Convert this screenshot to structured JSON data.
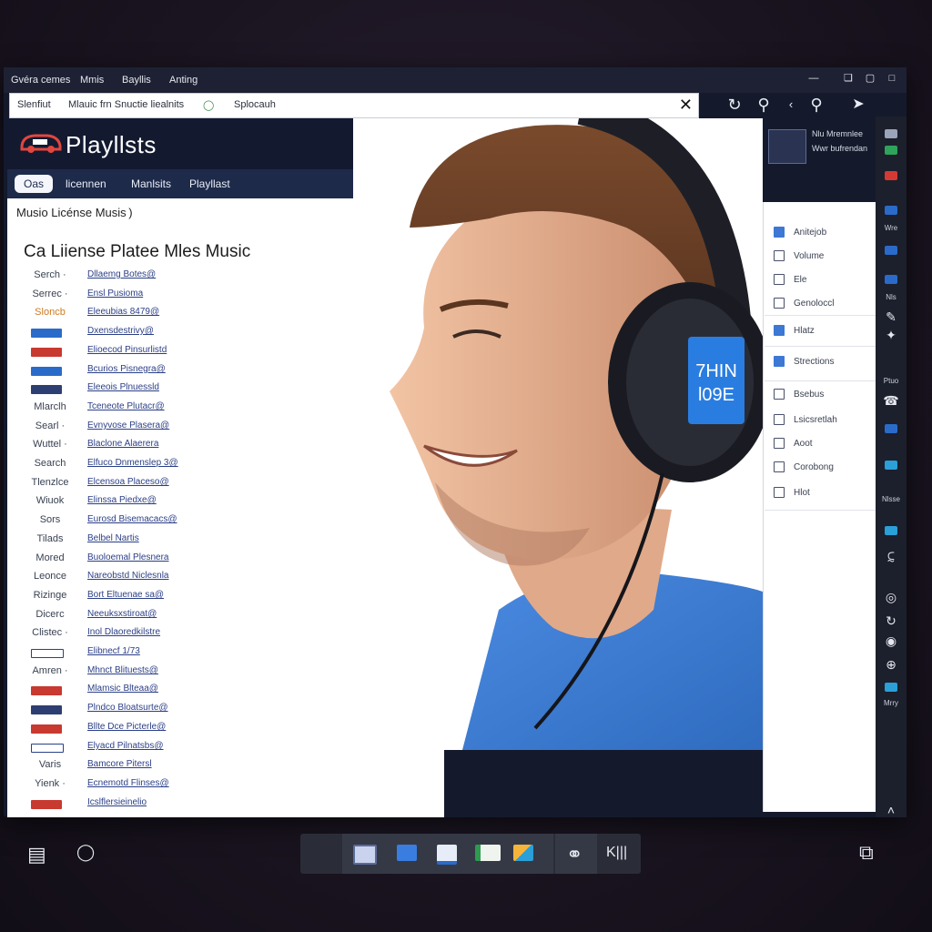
{
  "menubar": {
    "items": [
      "Gvéra cemes",
      "Mmis",
      "Bayllis",
      "Anting"
    ]
  },
  "addressbar": {
    "left_text": "Slenfiut",
    "path_text": "Mlauic frn Snuctie liealnits",
    "status_text": "Splocauh"
  },
  "header": {
    "title": "Playllsts"
  },
  "nav": {
    "tabs": [
      "Oas",
      "licennen",
      "Manlsits",
      "Playllast"
    ]
  },
  "breadcrumb": "Musio Licénse Musis )",
  "page_title": "Ca Liiense Platee  Mles Music",
  "rows": [
    {
      "label": "Serch ·",
      "value": "Dllaemg Botes@"
    },
    {
      "label": "Serrec ·",
      "value": "Ensl Pusioma"
    },
    {
      "label": "Sloncb",
      "value": "Eleeubias 8479@"
    },
    {
      "badge": "blue",
      "value": "Dxensdestrivy@"
    },
    {
      "badge": "red",
      "value": "Elioecod Pinsurlistd"
    },
    {
      "badge": "blue",
      "value": "Bcurios Pisnegra@"
    },
    {
      "badge": "navy",
      "value": "Eleeois Plnuessld"
    },
    {
      "label": "Mlarclh",
      "value": "Tceneote Plutacr@"
    },
    {
      "label": "Searl ·",
      "value": "Evnyvose Plasera@"
    },
    {
      "label": "Wuttel ·",
      "value": "Blaclone Alaerera"
    },
    {
      "label": "Search",
      "value": "Elfuco Dnmenslep 3@"
    },
    {
      "label": "Tlenzlce",
      "value": "Elcensoa Placeso@"
    },
    {
      "label": "Wiuok",
      "value": "Elinssa Piedxe@"
    },
    {
      "label": "Sors",
      "value": "Eurosd Bisemacacs@"
    },
    {
      "label": "Tilads",
      "value": "Belbel Nartis"
    },
    {
      "label": "Mored",
      "value": "Buoloemal Plesnera"
    },
    {
      "label": "Leonce",
      "value": "Nareobstd Niclesnla"
    },
    {
      "label": "Rizinge",
      "value": "Bort Eltuenae sa@"
    },
    {
      "label": "Dicerc",
      "value": "Neeuksxstiroat@"
    },
    {
      "label": "Clistec ·",
      "value": "Inol Dlaoredkilstre"
    },
    {
      "badge": "outline",
      "value": "Elibnecf 1/73"
    },
    {
      "label": "Amren ·",
      "value": "Mhnct Blituests@"
    },
    {
      "badge": "red",
      "value": "Mlamsic Blteaa@"
    },
    {
      "badge": "navy",
      "value": "Plndco Bloatsurte@"
    },
    {
      "badge": "red",
      "value": "Bllte Dce Picterle@"
    },
    {
      "badge": "outline",
      "value": "Elyacd Pilnatsbs@"
    },
    {
      "label": "Varis",
      "value": "Bamcore Pitersl"
    },
    {
      "label": "Yienk ·",
      "value": "Ecnemotd Flinses@"
    },
    {
      "badge": "red",
      "value": "Icslflersieinelio"
    }
  ],
  "profile": {
    "line1": "Nlu Mremnlee",
    "line2": "Wwr bufrendan"
  },
  "dropdown": {
    "items": [
      "Anitejob",
      "Volume",
      "Ele",
      "Genoloccl",
      "Hlatz",
      "Strections",
      "Bsebus",
      "Lsicsretlah",
      "Aoot",
      "Corobong",
      "Hlot"
    ]
  },
  "rail": {
    "labels": [
      "Wre",
      "Nls",
      "Ptuo",
      "Nlsse",
      "Mrry"
    ]
  },
  "headphone_badge": {
    "line1": "7HIN",
    "line2": "l09E"
  },
  "colors": {
    "accent": "#2a6bc9",
    "badge_red": "#c8392f",
    "header_bg": "#131a30",
    "nav_bg": "#1e2a4a",
    "shirt_blue": "#3d7dd6"
  }
}
